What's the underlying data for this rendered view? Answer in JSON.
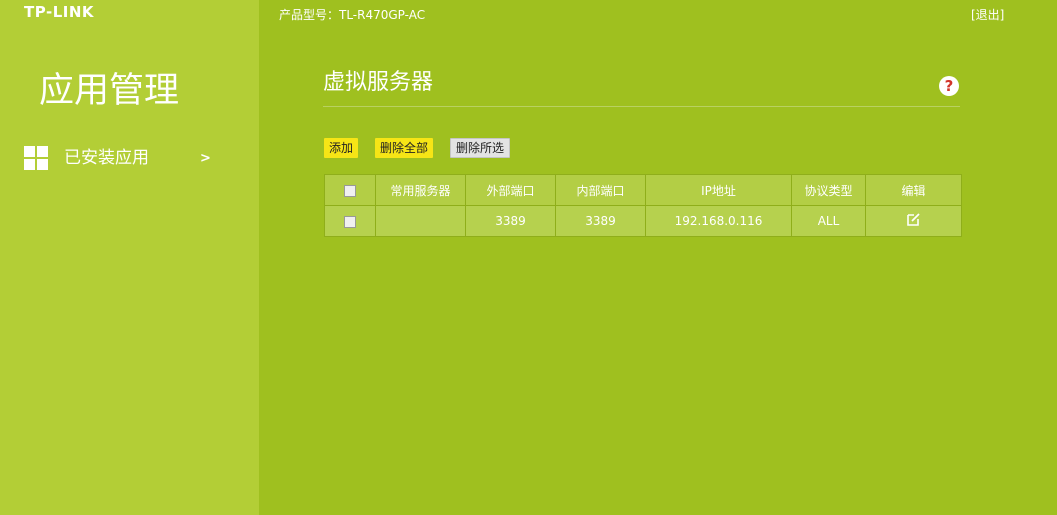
{
  "brand": {
    "logo_text": "TP-LINK"
  },
  "header": {
    "model_label": "产品型号：TL-R470GP-AC",
    "logout_label": "[退出]"
  },
  "sidebar": {
    "section_title": "应用管理",
    "items": [
      {
        "label": "已安装应用",
        "icon": "grid-icon",
        "chevron": ">"
      }
    ]
  },
  "main": {
    "title": "虚拟服务器",
    "help_icon": "help-icon",
    "toolbar": {
      "add_label": "添加",
      "delete_all_label": "删除全部",
      "delete_selected_label": "删除所选"
    },
    "table": {
      "columns": [
        "",
        "常用服务器",
        "外部端口",
        "内部端口",
        "IP地址",
        "协议类型",
        "编辑"
      ],
      "rows": [
        {
          "checked": false,
          "service": "",
          "external_port": "3389",
          "internal_port": "3389",
          "ip": "192.168.0.116",
          "protocol": "ALL",
          "edit_icon": "edit-icon"
        }
      ]
    }
  },
  "colors": {
    "main_bg": "#9fc01f",
    "sidebar_bg": "#b3ce36",
    "button_yellow": "#f6e516",
    "button_grey": "#e3e3e3",
    "help_mark": "#d2352a"
  }
}
